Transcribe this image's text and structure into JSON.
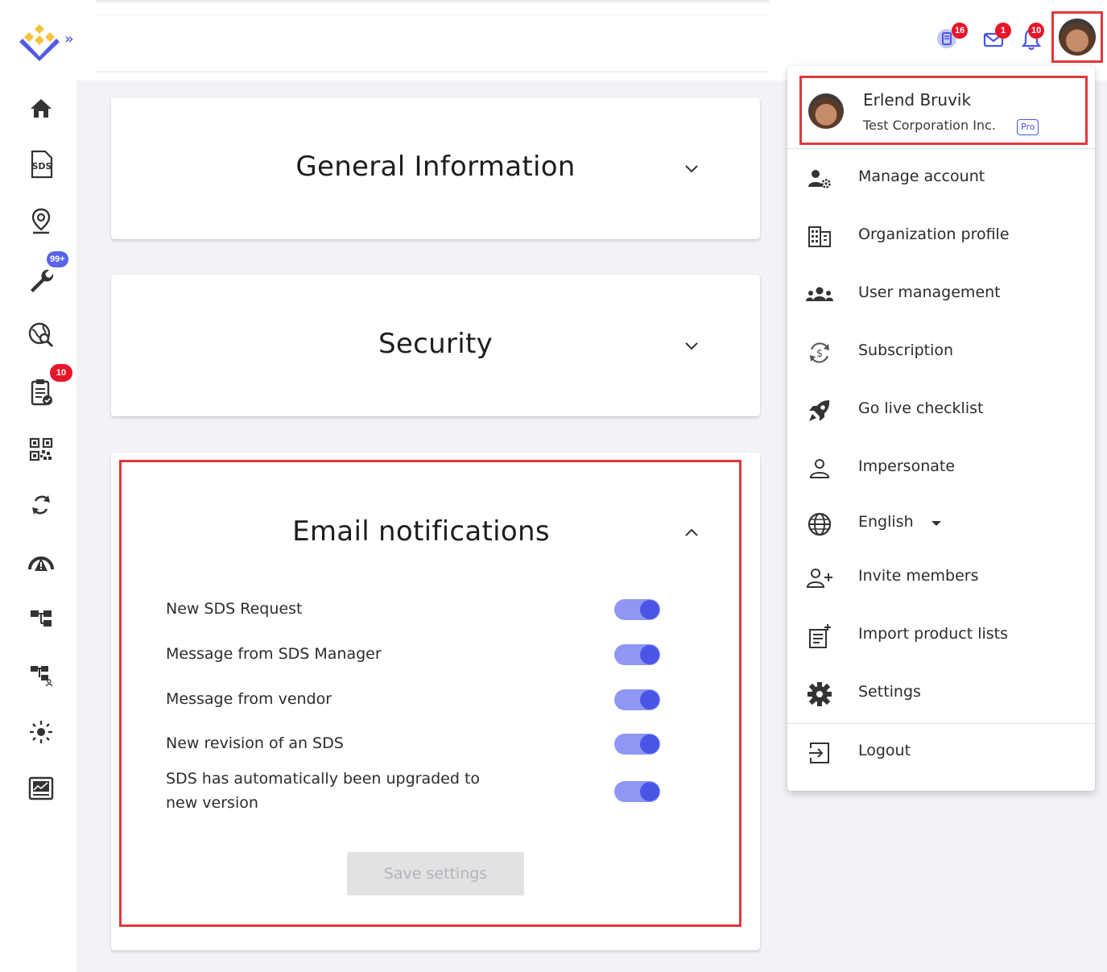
{
  "header": {
    "badges": {
      "documents": "16",
      "messages": "1",
      "notifications": "10"
    }
  },
  "sidebar": {
    "items": [
      {
        "name": "home"
      },
      {
        "name": "sds",
        "label": "SDS"
      },
      {
        "name": "location"
      },
      {
        "name": "tools",
        "badge": "99+"
      },
      {
        "name": "global-search"
      },
      {
        "name": "tasks",
        "badge": "10"
      },
      {
        "name": "qr-code"
      },
      {
        "name": "sync"
      },
      {
        "name": "hazard"
      },
      {
        "name": "hierarchy"
      },
      {
        "name": "hierarchy-users"
      },
      {
        "name": "settings-spark"
      },
      {
        "name": "reports"
      }
    ]
  },
  "cards": {
    "general": {
      "title": "General Information"
    },
    "security": {
      "title": "Security"
    },
    "email": {
      "title": "Email notifications",
      "rows": [
        {
          "label": "New SDS Request",
          "enabled": true
        },
        {
          "label": "Message from SDS Manager",
          "enabled": true
        },
        {
          "label": "Message from vendor",
          "enabled": true
        },
        {
          "label": "New revision of an SDS",
          "enabled": true
        },
        {
          "label": "SDS has automatically been upgraded to",
          "label2": "new version",
          "enabled": true
        }
      ],
      "save_label": "Save settings"
    }
  },
  "menu": {
    "user": {
      "name": "Erlend Bruvik",
      "org": "Test Corporation Inc.",
      "plan": "Pro"
    },
    "items": [
      {
        "label": "Manage account",
        "icon": "user-gear-icon"
      },
      {
        "label": "Organization profile",
        "icon": "building-icon"
      },
      {
        "label": "User management",
        "icon": "users-icon"
      },
      {
        "label": "Subscription",
        "icon": "dollar-cycle-icon"
      },
      {
        "label": "Go live checklist",
        "icon": "rocket-icon"
      },
      {
        "label": "Impersonate",
        "icon": "person-icon"
      },
      {
        "label": "English",
        "icon": "globe-icon"
      },
      {
        "label": "Invite members",
        "icon": "user-plus-icon"
      },
      {
        "label": "Import product lists",
        "icon": "import-list-icon"
      },
      {
        "label": "Settings",
        "icon": "gear-icon"
      }
    ],
    "logout": "Logout"
  }
}
